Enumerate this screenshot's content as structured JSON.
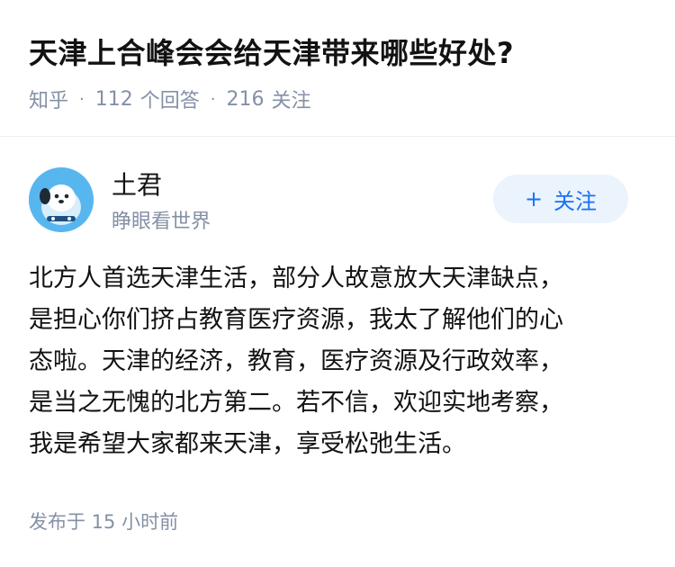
{
  "question": {
    "title": "天津上合峰会会给天津带来哪些好处?",
    "source": "知乎",
    "answer_count": "112",
    "answer_label": "个回答",
    "follower_count": "216",
    "follower_label": "关注"
  },
  "author": {
    "avatar_icon": "cartoon-dog-avatar-icon",
    "name": "土君",
    "bio": "睁眼看世界"
  },
  "follow_button": {
    "icon": "plus-icon",
    "label": "关注"
  },
  "answer": {
    "text": "北方人首选天津生活，部分人故意放大天津缺点，\n是担心你们挤占教育医疗资源，我太了解他们的心\n态啦。天津的经济，教育，医疗资源及行政效率，\n是当之无愧的北方第二。若不信，欢迎实地考察，\n我是希望大家都来天津，享受松弛生活。",
    "published": "发布于 15 小时前"
  },
  "colors": {
    "title": "#121212",
    "meta": "#8590a6",
    "follow_bg": "#ebf3fc",
    "follow_text": "#1772f6",
    "avatar_bg": "#58b6ef"
  }
}
